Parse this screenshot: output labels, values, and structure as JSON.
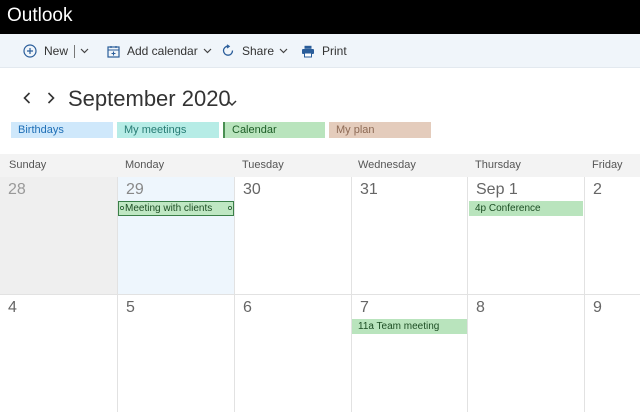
{
  "app": {
    "title": "Outlook"
  },
  "toolbar": {
    "new_label": "New",
    "add_calendar_label": "Add calendar",
    "share_label": "Share",
    "print_label": "Print"
  },
  "header": {
    "month_title": "September 2020"
  },
  "calendars": [
    {
      "label": "Birthdays",
      "color": "#cfe8fb"
    },
    {
      "label": "My meetings",
      "color": "#b6ece6"
    },
    {
      "label": "Calendar",
      "color": "#b9e4bd"
    },
    {
      "label": "My plan",
      "color": "#e4ccbc"
    }
  ],
  "weekdays": [
    "Sunday",
    "Monday",
    "Tuesday",
    "Wednesday",
    "Thursday",
    "Friday"
  ],
  "weeks": [
    {
      "days": [
        "28",
        "29",
        "30",
        "31",
        "Sep 1",
        "2"
      ]
    },
    {
      "days": [
        "4",
        "5",
        "6",
        "7",
        "8",
        "9"
      ]
    }
  ],
  "events": {
    "meeting_with_clients": "Meeting with clients",
    "conference": "4p Conference",
    "team_meeting": "11a Team meeting"
  },
  "colors": {
    "titlebar": "#000000",
    "toolbar": "#f0f5fa",
    "accent": "#0078d4",
    "event_green": "#b9e4bd",
    "out_of_month": "#efefef",
    "today": "#eef6fd"
  }
}
